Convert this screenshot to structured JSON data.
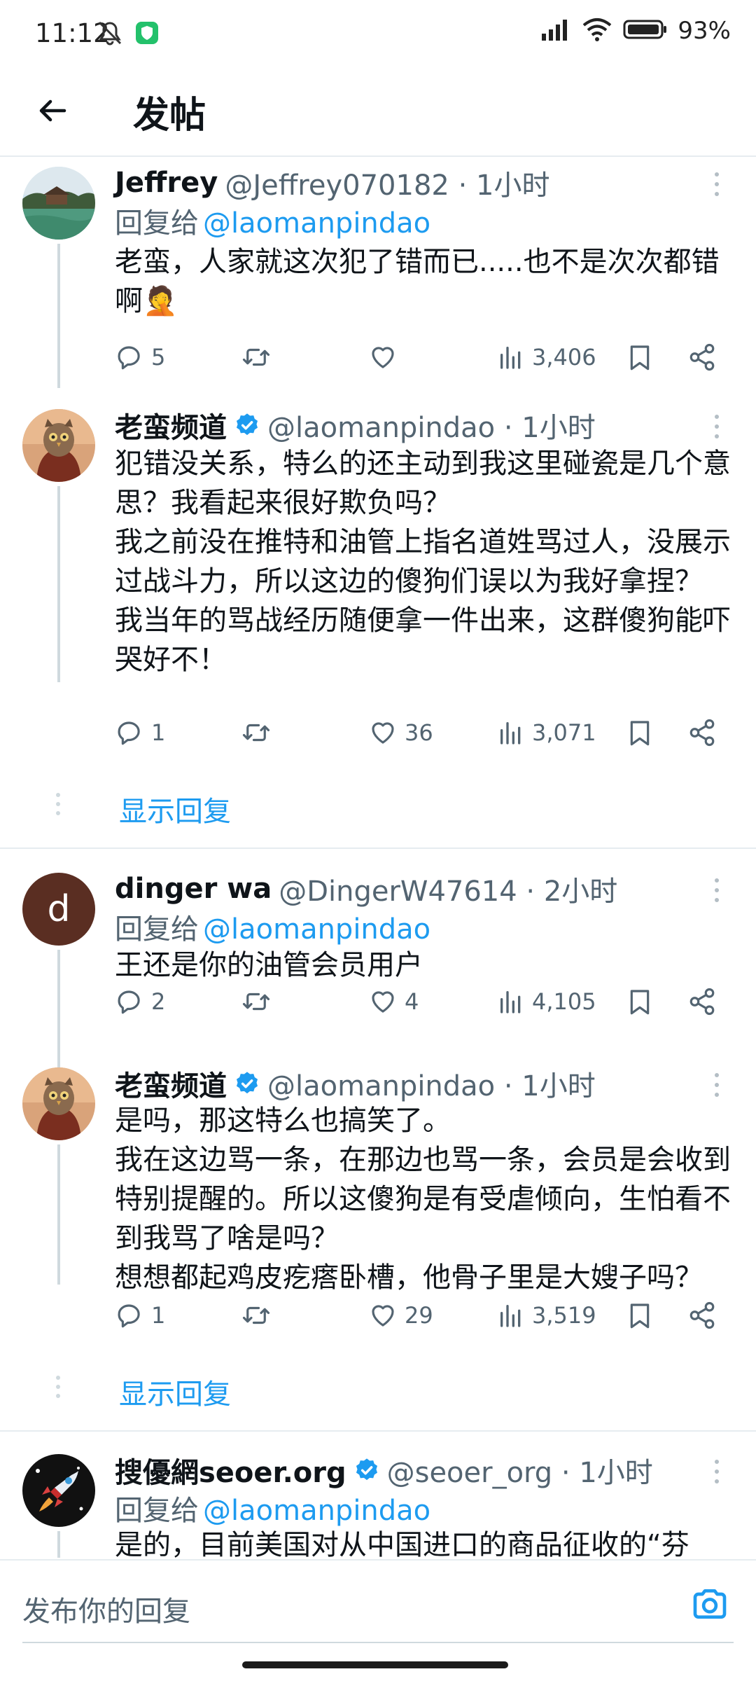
{
  "status_bar": {
    "time": "11:12",
    "battery": "93%"
  },
  "app_bar": {
    "title": "发帖"
  },
  "colors": {
    "accent": "#1d9bf0",
    "text": "#0f1419",
    "muted": "#536471",
    "border": "#e6ecf0"
  },
  "tweets": [
    {
      "name": "Jeffrey",
      "meta": "@Jeffrey070182 · 1小时",
      "verified": false,
      "reply_prefix": "回复给",
      "reply_handle": "@laomanpindao",
      "body": "老蛮，人家就这次犯了错而已.....也不是次次都错啊🤦",
      "replies": "5",
      "likes": "",
      "views": "3,406",
      "avatar_icon": "landscape-avatar"
    },
    {
      "name": "老蛮频道",
      "meta": "@laomanpindao · 1小时",
      "verified": true,
      "body": "犯错没关系，特么的还主动到我这里碰瓷是几个意思？我看起来很好欺负吗？\n我之前没在推特和油管上指名道姓骂过人，没展示过战斗力，所以这边的傻狗们误以为我好拿捏？\n我当年的骂战经历随便拿一件出来，这群傻狗能吓哭好不！",
      "replies": "1",
      "likes": "36",
      "views": "3,071",
      "show_replies": "显示回复",
      "avatar_icon": "owl-avatar"
    },
    {
      "name": "dinger wa",
      "meta": "@DingerW47614 · 2小时",
      "verified": false,
      "reply_prefix": "回复给",
      "reply_handle": "@laomanpindao",
      "body": "王还是你的油管会员用户",
      "replies": "2",
      "likes": "4",
      "views": "4,105",
      "avatar_letter": "d"
    },
    {
      "name": "老蛮频道",
      "meta": "@laomanpindao · 1小时",
      "verified": true,
      "body": "是吗，那这特么也搞笑了。\n我在这边骂一条，在那边也骂一条，会员是会收到特别提醒的。所以这傻狗是有受虐倾向，生怕看不到我骂了啥是吗？\n想想都起鸡皮疙瘩卧槽，他骨子里是大嫂子吗？",
      "replies": "1",
      "likes": "29",
      "views": "3,519",
      "show_replies": "显示回复",
      "avatar_icon": "owl-avatar"
    },
    {
      "name": "搜優網seoer.org",
      "meta": "@seoer_org · 1小时",
      "verified": true,
      "reply_prefix": "回复给",
      "reply_handle": "@laomanpindao",
      "body": "是的，目前美国对从中国进口的商品征收的“芬",
      "avatar_icon": "rocket-avatar"
    }
  ],
  "compose": {
    "placeholder": "发布你的回复"
  }
}
